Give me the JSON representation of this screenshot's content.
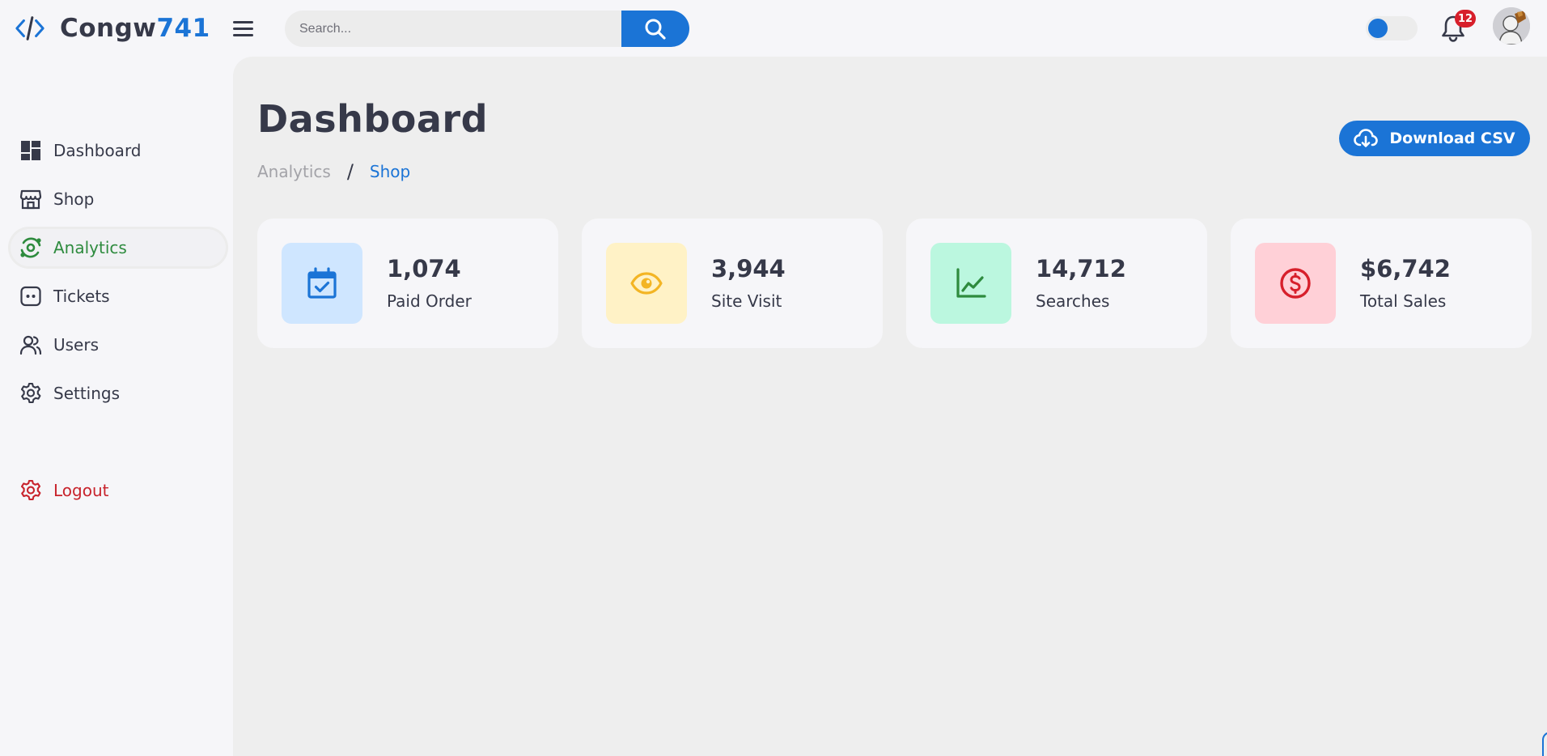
{
  "brand": {
    "name_main": "Congw",
    "name_accent": "741",
    "color": "#1b74d6"
  },
  "search": {
    "placeholder": "Search..."
  },
  "notifications": {
    "count": "12"
  },
  "theme_toggle": {
    "on": true
  },
  "sidebar": {
    "items": [
      {
        "label": "Dashboard",
        "icon": "dashboard-icon"
      },
      {
        "label": "Shop",
        "icon": "shop-icon"
      },
      {
        "label": "Analytics",
        "icon": "analytics-icon",
        "active": true
      },
      {
        "label": "Tickets",
        "icon": "tickets-icon"
      },
      {
        "label": "Users",
        "icon": "users-icon"
      },
      {
        "label": "Settings",
        "icon": "settings-icon"
      }
    ],
    "logout_label": "Logout"
  },
  "header": {
    "title": "Dashboard",
    "breadcrumb": [
      "Analytics",
      "Shop"
    ],
    "breadcrumb_sep": "/",
    "download_label": "Download CSV"
  },
  "stats": [
    {
      "value": "1,074",
      "label": "Paid Order",
      "icon": "calendar-check-icon",
      "bg": "#cfe6ff",
      "color": "#1b74d6"
    },
    {
      "value": "3,944",
      "label": "Site Visit",
      "icon": "eye-icon",
      "bg": "#fff2c6",
      "color": "#f3b524"
    },
    {
      "value": "14,712",
      "label": "Searches",
      "icon": "line-chart-icon",
      "bg": "#bbf7df",
      "color": "#2e8b3e"
    },
    {
      "value": "$6,742",
      "label": "Total Sales",
      "icon": "dollar-icon",
      "bg": "#ffd0d7",
      "color": "#d71f2b"
    }
  ]
}
